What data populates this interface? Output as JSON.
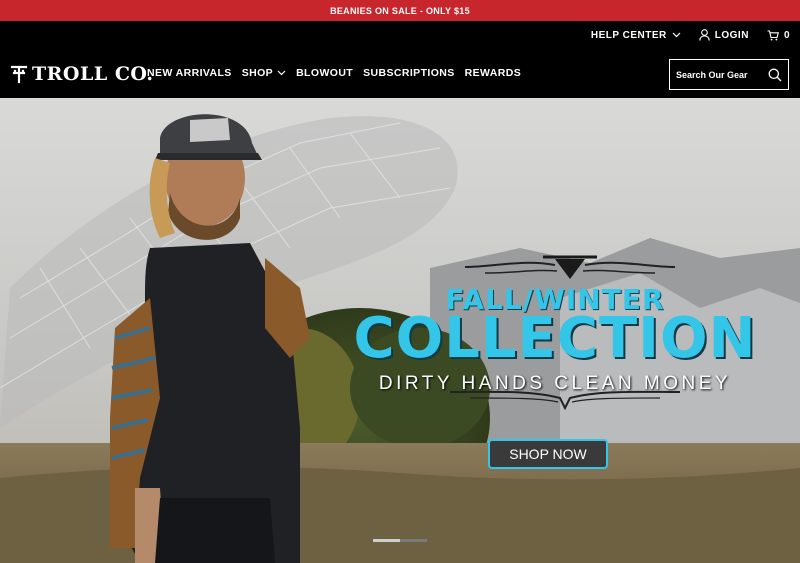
{
  "promo": {
    "text": "BEANIES ON SALE - ONLY $15"
  },
  "utility_nav": {
    "help_center": "HELP CENTER",
    "login": "LOGIN",
    "cart_count": "0"
  },
  "logo": {
    "text": "TROLL CO."
  },
  "main_nav": {
    "items": [
      {
        "label": "NEW ARRIVALS",
        "has_dropdown": false
      },
      {
        "label": "SHOP",
        "has_dropdown": true
      },
      {
        "label": "BLOWOUT",
        "has_dropdown": false
      },
      {
        "label": "SUBSCRIPTIONS",
        "has_dropdown": false
      },
      {
        "label": "REWARDS",
        "has_dropdown": false
      }
    ]
  },
  "search": {
    "placeholder": "Search Our Gear"
  },
  "hero": {
    "line1": "FALL/WINTER",
    "line2": "COLLECTION",
    "line3": "DIRTY HANDS CLEAN MONEY",
    "cta": "SHOP NOW",
    "slide_count": 2,
    "active_slide": 1
  },
  "colors": {
    "promo_bg": "#c8262d",
    "accent": "#33c6e8",
    "header_bg": "#000000"
  },
  "icons": [
    "chevron-down-icon",
    "user-icon",
    "cart-icon",
    "search-icon",
    "logo-icon"
  ]
}
